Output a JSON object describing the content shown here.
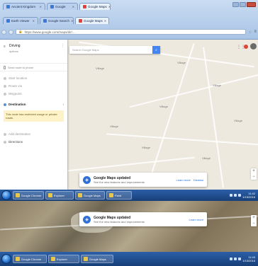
{
  "browser_tabs_row1": [
    {
      "label": "Ancient Kingdom",
      "icon": "page-icon"
    },
    {
      "label": "Google",
      "icon": "page-icon"
    },
    {
      "label": "Google Maps",
      "icon": "maps-icon",
      "active": true
    }
  ],
  "browser_tabs_row2": [
    {
      "label": "Earth Viewer",
      "icon": "page-icon"
    },
    {
      "label": "Google Search",
      "icon": "page-icon"
    },
    {
      "label": "Google Maps",
      "icon": "maps-icon",
      "active": true
    }
  ],
  "address_bar": {
    "url": "https://www.google.com/maps/dir/..."
  },
  "sidebar": {
    "title": "Driving",
    "subtitle": "options",
    "send_label": "Send route to phone",
    "items": [
      {
        "label": "Start location"
      },
      {
        "label": "Route via"
      },
      {
        "label": "Waypoint"
      },
      {
        "label": "Destination",
        "active": true
      },
      {
        "label": "Add destination"
      },
      {
        "label": "Directions"
      }
    ],
    "warning": "This route has restricted usage or private roads."
  },
  "search": {
    "placeholder": "Search Google Maps"
  },
  "toast": {
    "title": "Google Maps updated",
    "message": "See the new features and improvements",
    "link": "Learn more",
    "dismiss": "Dismiss"
  },
  "toast2": {
    "title": "Google Maps updated",
    "message": "See the new features and improvements",
    "link": "Learn more"
  },
  "map_labels": [
    "Village",
    "Village",
    "Village",
    "Village",
    "Village",
    "Village",
    "Village",
    "Village"
  ],
  "taskbar_apps": [
    {
      "label": "Google Chrome"
    },
    {
      "label": "Explorer"
    },
    {
      "label": "Google Maps"
    },
    {
      "label": "Paint"
    }
  ],
  "taskbar_apps2": [
    {
      "label": "Google Chrome"
    },
    {
      "label": "Explorer"
    },
    {
      "label": "Google Maps"
    }
  ],
  "clock": {
    "time": "11:42",
    "date": "1/15/2016"
  },
  "clock2": {
    "time": "11:43",
    "date": "1/15/2016"
  },
  "colors": {
    "accent": "#4285f4",
    "taskbar": "#1f4b8a",
    "map_bg": "#ede9df",
    "warning_bg": "#fdf2c8"
  }
}
